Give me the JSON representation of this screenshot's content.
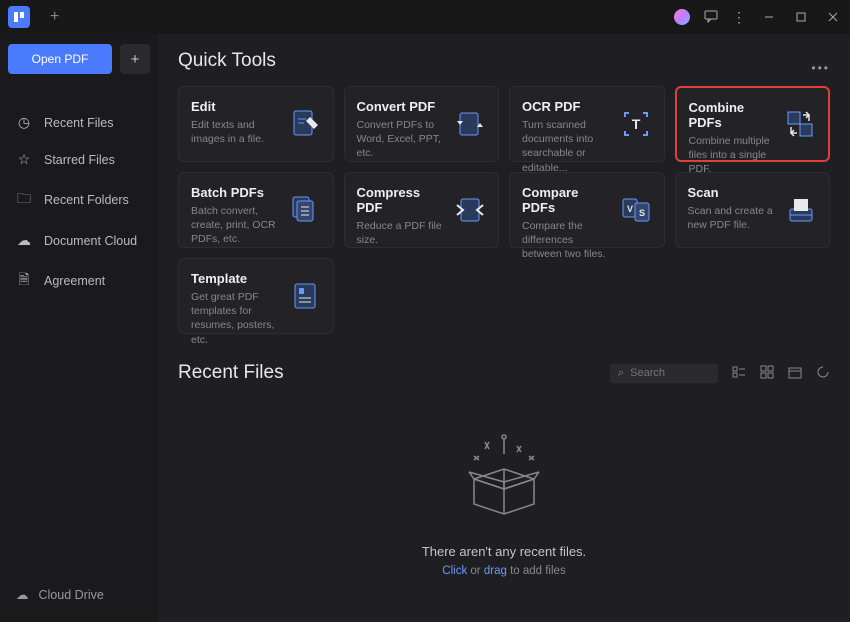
{
  "titlebar": {
    "new_tab": "+"
  },
  "sidebar": {
    "open_label": "Open PDF",
    "items": [
      {
        "icon": "clock-icon",
        "label": "Recent Files"
      },
      {
        "icon": "star-icon",
        "label": "Starred Files"
      },
      {
        "icon": "folder-icon",
        "label": "Recent Folders"
      },
      {
        "icon": "cloud-icon",
        "label": "Document Cloud"
      },
      {
        "icon": "doc-icon",
        "label": "Agreement"
      }
    ],
    "bottom_label": "Cloud Drive"
  },
  "quick_tools": {
    "heading": "Quick Tools",
    "cards": [
      {
        "title": "Edit",
        "desc": "Edit texts and images in a file.",
        "icon": "edit-icon"
      },
      {
        "title": "Convert PDF",
        "desc": "Convert PDFs to Word, Excel, PPT, etc.",
        "icon": "convert-icon"
      },
      {
        "title": "OCR PDF",
        "desc": "Turn scanned documents into searchable or editable...",
        "icon": "ocr-icon"
      },
      {
        "title": "Combine PDFs",
        "desc": "Combine multiple files into a single PDF.",
        "icon": "combine-icon",
        "highlight": true
      },
      {
        "title": "Batch PDFs",
        "desc": "Batch convert, create, print, OCR PDFs, etc.",
        "icon": "batch-icon"
      },
      {
        "title": "Compress PDF",
        "desc": "Reduce a PDF file size.",
        "icon": "compress-icon"
      },
      {
        "title": "Compare PDFs",
        "desc": "Compare the differences between two files.",
        "icon": "compare-icon"
      },
      {
        "title": "Scan",
        "desc": "Scan and create a new PDF file.",
        "icon": "scan-icon"
      },
      {
        "title": "Template",
        "desc": "Get great PDF templates for resumes, posters, etc.",
        "icon": "template-icon"
      }
    ]
  },
  "recent": {
    "heading": "Recent Files",
    "search_placeholder": "Search",
    "empty1": "There aren't any recent files.",
    "empty2_click": "Click",
    "empty2_or": " or ",
    "empty2_drag": "drag",
    "empty2_rest": " to add files"
  }
}
